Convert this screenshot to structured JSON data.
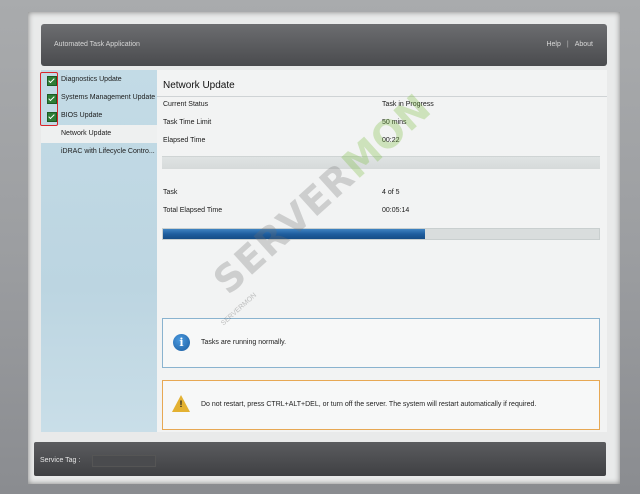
{
  "header": {
    "app_title": "Automated Task Application",
    "help_label": "Help",
    "about_label": "About"
  },
  "sidebar": {
    "items": [
      {
        "label": "Diagnostics Update",
        "checked": true
      },
      {
        "label": "Systems Management Update",
        "checked": true
      },
      {
        "label": "BIOS Update",
        "checked": true
      },
      {
        "label": "Network Update",
        "active": true
      },
      {
        "label": "iDRAC with Lifecycle Contro..."
      }
    ]
  },
  "main": {
    "title": "Network Update",
    "status_rows": [
      {
        "label": "Current Status",
        "value": "Task in Progress"
      },
      {
        "label": "Task Time Limit",
        "value": "50 mins"
      },
      {
        "label": "Elapsed Time",
        "value": "00:22"
      }
    ],
    "task_rows": [
      {
        "label": "Task",
        "value": "4 of 5"
      },
      {
        "label": "Total Elapsed Time",
        "value": "00:05:14"
      }
    ],
    "progress_fraction": 0.6,
    "info_message": "Tasks are running normally.",
    "warning_message": "Do not restart, press CTRL+ALT+DEL, or turn off the server.  The system will restart automatically if required."
  },
  "footer": {
    "service_tag_label": "Service Tag :"
  },
  "watermark": {
    "part1": "SERVER",
    "part2": "MON",
    "subtext": "SERVERMON"
  },
  "colors": {
    "check_green": "#2e7d36",
    "highlight_red": "#d9252b",
    "progress_blue": "#1f5e9f",
    "info_border": "#8ab3cf",
    "warning_border": "#e7a854"
  },
  "icons": [
    "check-icon",
    "info-icon",
    "warning-icon"
  ]
}
